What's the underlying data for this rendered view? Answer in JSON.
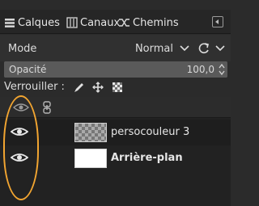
{
  "tabs": [
    {
      "label": "Calques",
      "icon": "layers-icon"
    },
    {
      "label": "Canaux",
      "icon": "channels-icon"
    },
    {
      "label": "Chemins",
      "icon": "paths-icon"
    }
  ],
  "mode": {
    "label": "Mode",
    "value": "Normal"
  },
  "opacity": {
    "label": "Opacité",
    "value": "100,0",
    "percent": 100
  },
  "lock": {
    "label": "Verrouiller :",
    "icons": [
      "lock-pixels-icon",
      "lock-position-icon",
      "lock-alpha-icon"
    ]
  },
  "layers": [
    {
      "name": "persocouleur 3",
      "thumbnail": "transparent",
      "visible": true,
      "bold": false
    },
    {
      "name": "Arrière-plan",
      "thumbnail": "white",
      "visible": true,
      "bold": true
    }
  ],
  "colors": {
    "highlight": "#f2a531",
    "background": "#2b2b2b"
  }
}
